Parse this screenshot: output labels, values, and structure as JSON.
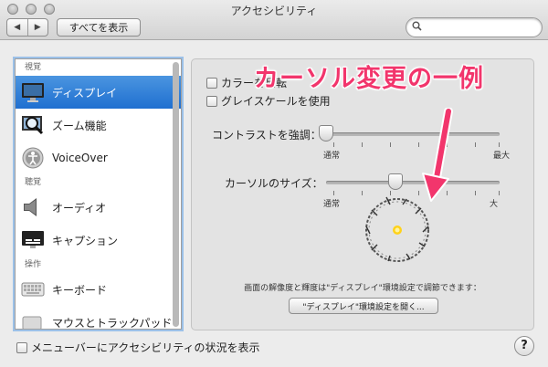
{
  "window": {
    "title": "アクセシビリティ"
  },
  "toolbar": {
    "back": "◀",
    "forward": "▶",
    "show_all": "すべてを表示",
    "search_placeholder": ""
  },
  "sidebar": {
    "sections": [
      {
        "title": "視覚",
        "items": [
          {
            "label": "ディスプレイ",
            "icon": "display-icon",
            "selected": true
          },
          {
            "label": "ズーム機能",
            "icon": "zoom-icon",
            "selected": false
          },
          {
            "label": "VoiceOver",
            "icon": "voiceover-icon",
            "selected": false
          }
        ]
      },
      {
        "title": "聴覚",
        "items": [
          {
            "label": "オーディオ",
            "icon": "speaker-icon",
            "selected": false
          },
          {
            "label": "キャプション",
            "icon": "caption-icon",
            "selected": false
          }
        ]
      },
      {
        "title": "操作",
        "items": [
          {
            "label": "キーボード",
            "icon": "keyboard-icon",
            "selected": false
          },
          {
            "label": "マウスとトラックパッド",
            "icon": "mouse-icon",
            "selected": false
          }
        ]
      }
    ]
  },
  "display": {
    "invert_label": "カラーを反転",
    "grayscale_label": "グレイスケールを使用",
    "contrast_label": "コントラストを強調：",
    "contrast_min": "通常",
    "contrast_max": "最大",
    "contrast_value": 0.0,
    "cursor_label": "カーソルのサイズ：",
    "cursor_min": "通常",
    "cursor_max": "大",
    "cursor_value": 0.4,
    "note": "画面の解像度と輝度は\"ディスプレイ\"環境設定で調節できます：",
    "open_display_button": "\"ディスプレイ\"環境設定を開く..."
  },
  "annotation": {
    "text": "カーソル変更の一例",
    "color": "#f2356c"
  },
  "footer": {
    "show_status_label": "メニューバーにアクセシビリティの状況を表示",
    "help": "?"
  },
  "colors": {
    "selection": "#2a79d6",
    "focus_ring": "#9cc1e8"
  }
}
